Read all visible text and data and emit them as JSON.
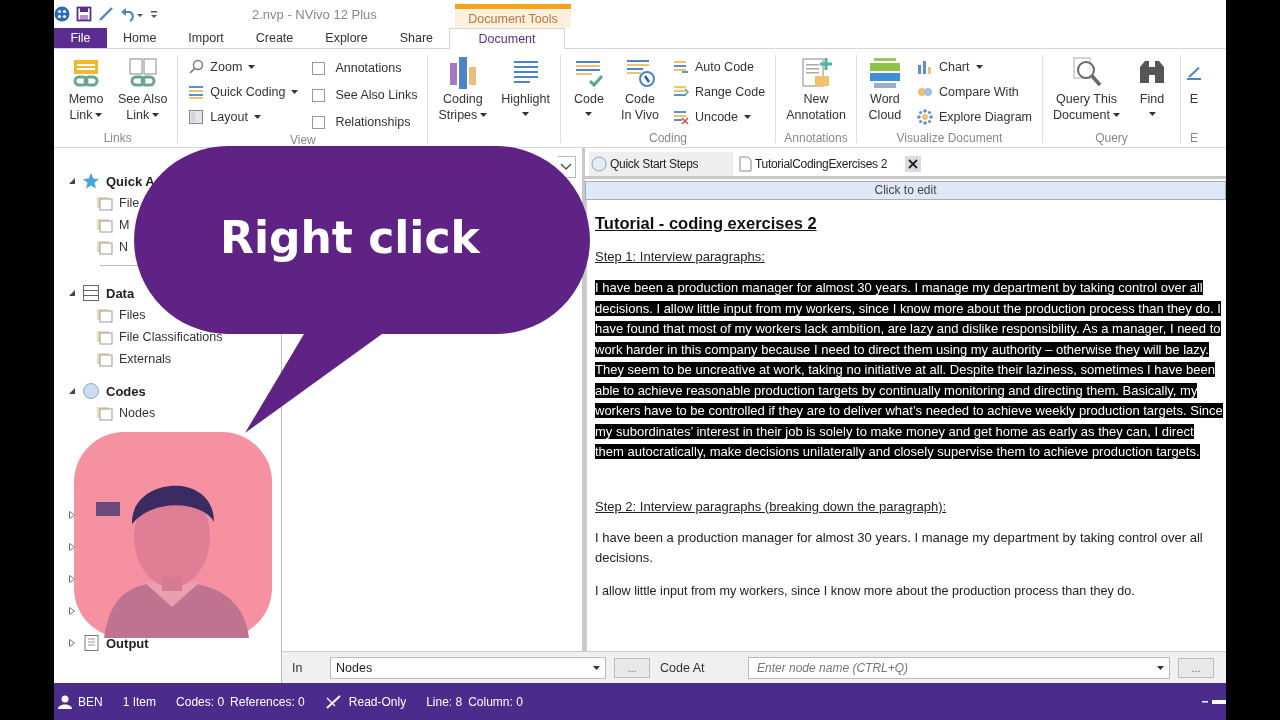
{
  "window": {
    "title": "2.nvp - NVivo 12 Plus",
    "context_group": "Document Tools"
  },
  "ribbon_tabs": [
    {
      "label": "File",
      "kind": "file",
      "selected": false
    },
    {
      "label": "Home",
      "kind": "tab",
      "selected": false
    },
    {
      "label": "Import",
      "kind": "tab",
      "selected": false
    },
    {
      "label": "Create",
      "kind": "tab",
      "selected": false
    },
    {
      "label": "Explore",
      "kind": "tab",
      "selected": false
    },
    {
      "label": "Share",
      "kind": "tab",
      "selected": false
    },
    {
      "label": "Document",
      "kind": "context",
      "selected": true
    }
  ],
  "ribbon_groups": [
    {
      "label": "Links",
      "items": [
        {
          "kind": "large",
          "lines": [
            "Memo",
            "Link"
          ],
          "dropdown": true
        },
        {
          "kind": "large",
          "lines": [
            "See Also",
            "Link"
          ],
          "dropdown": true
        }
      ]
    },
    {
      "label": "View",
      "items": [
        {
          "kind": "small",
          "label": "Zoom",
          "dropdown": true
        },
        {
          "kind": "small",
          "label": "Quick Coding",
          "dropdown": true
        },
        {
          "kind": "small",
          "label": "Layout",
          "dropdown": true
        },
        {
          "kind": "check",
          "label": "Annotations",
          "checked": false
        },
        {
          "kind": "check",
          "label": "See Also Links",
          "checked": false
        },
        {
          "kind": "check",
          "label": "Relationships",
          "checked": false
        }
      ]
    },
    {
      "items": [
        {
          "kind": "large",
          "lines": [
            "Coding",
            "Stripes"
          ],
          "dropdown": true
        },
        {
          "kind": "large",
          "lines": [
            "Highlight"
          ],
          "dropdown": true
        }
      ]
    },
    {
      "label": "Coding",
      "items": [
        {
          "kind": "large",
          "lines": [
            "Code"
          ],
          "dropdown": true
        },
        {
          "kind": "large",
          "lines": [
            "Code",
            "In Vivo"
          ]
        },
        {
          "kind": "small",
          "label": "Auto Code"
        },
        {
          "kind": "small",
          "label": "Range Code"
        },
        {
          "kind": "small",
          "label": "Uncode",
          "dropdown": true
        }
      ]
    },
    {
      "label": "Annotations",
      "items": [
        {
          "kind": "large",
          "lines": [
            "New",
            "Annotation"
          ]
        }
      ]
    },
    {
      "label": "Visualize Document",
      "items": [
        {
          "kind": "large",
          "lines": [
            "Word",
            "Cloud"
          ]
        },
        {
          "kind": "small",
          "label": "Chart",
          "dropdown": true
        },
        {
          "kind": "small",
          "label": "Compare With"
        },
        {
          "kind": "small",
          "label": "Explore Diagram"
        }
      ]
    },
    {
      "label": "Query",
      "items": [
        {
          "kind": "large",
          "lines": [
            "Query This",
            "Document"
          ],
          "dropdown": true
        },
        {
          "kind": "large",
          "lines": [
            "Find"
          ],
          "dropdown": true
        }
      ]
    },
    {
      "label": "E",
      "items": [
        {
          "kind": "large",
          "lines": [
            "E"
          ]
        }
      ]
    }
  ],
  "navigation": [
    {
      "label": "Quick A",
      "expanded": true,
      "children": [
        {
          "label": "File"
        },
        {
          "label": "M"
        },
        {
          "label": "N"
        }
      ]
    },
    {
      "label": "Data",
      "expanded": true,
      "children": [
        {
          "label": "Files"
        },
        {
          "label": "File Classifications"
        },
        {
          "label": "Externals"
        }
      ]
    },
    {
      "label": "Codes",
      "expanded": true,
      "children": [
        {
          "label": "Nodes"
        }
      ]
    },
    {
      "expanded": false
    },
    {
      "expanded": false
    },
    {
      "expanded": false
    },
    {
      "expanded": false
    },
    {
      "label": "Output",
      "expanded": false
    }
  ],
  "overlay": {
    "bubble_text": "Right click"
  },
  "document_tabs": [
    {
      "label": "Quick Start Steps",
      "selected": false,
      "closable": false
    },
    {
      "label": "TutorialCodingExercises 2",
      "selected": true,
      "closable": true
    }
  ],
  "edit_bar": "Click to edit",
  "document": [
    {
      "kind": "title",
      "text": "Tutorial - coding exercises 2"
    },
    {
      "kind": "heading",
      "text": "Step 1: Interview paragraphs:"
    },
    {
      "kind": "paragraph",
      "selected": true,
      "text": "I have been a production manager for almost 30 years. I manage my department by taking control over all decisions. I allow little input from my workers, since I know more about the production process than they do. I have found that most of my workers lack ambition, are lazy and dislike responsibility. As a manager, I need to work harder in this company because I need to direct them using my authority – otherwise they will be lazy. They seem to be uncreative at work, taking no initiative at all. Despite their laziness, sometimes I have been able to achieve reasonable production targets by continually monitoring and directing them. Basically, my workers have to be controlled if they are to deliver what’s needed to achieve weekly production targets. Since my subordinates’ interest in their job is solely to make money and get home as early as they can, I direct them autocratically, make decisions unilaterally and closely supervise them to achieve production targets."
    },
    {
      "kind": "heading",
      "text": "Step 2: Interview paragraphs (breaking down the paragraph):"
    },
    {
      "kind": "paragraph",
      "selected": false,
      "text": "I have been a production manager for almost 30 years. I manage my department by taking control over all decisions."
    },
    {
      "kind": "line",
      "selected": false,
      "text": "I allow little input from my workers, since I know more about the production process than they do."
    }
  ],
  "coding_bar": {
    "in_label": "In",
    "in_value": "Nodes",
    "code_at_label": "Code At",
    "node_placeholder": "Enter node name (CTRL+Q)",
    "browse": "..."
  },
  "status_bar": {
    "user": "BEN",
    "items": "1 Item",
    "codes": "Codes: 0",
    "references": "References: 0",
    "mode": "Read-Only",
    "line": "Line: 8",
    "column": "Column: 0"
  }
}
